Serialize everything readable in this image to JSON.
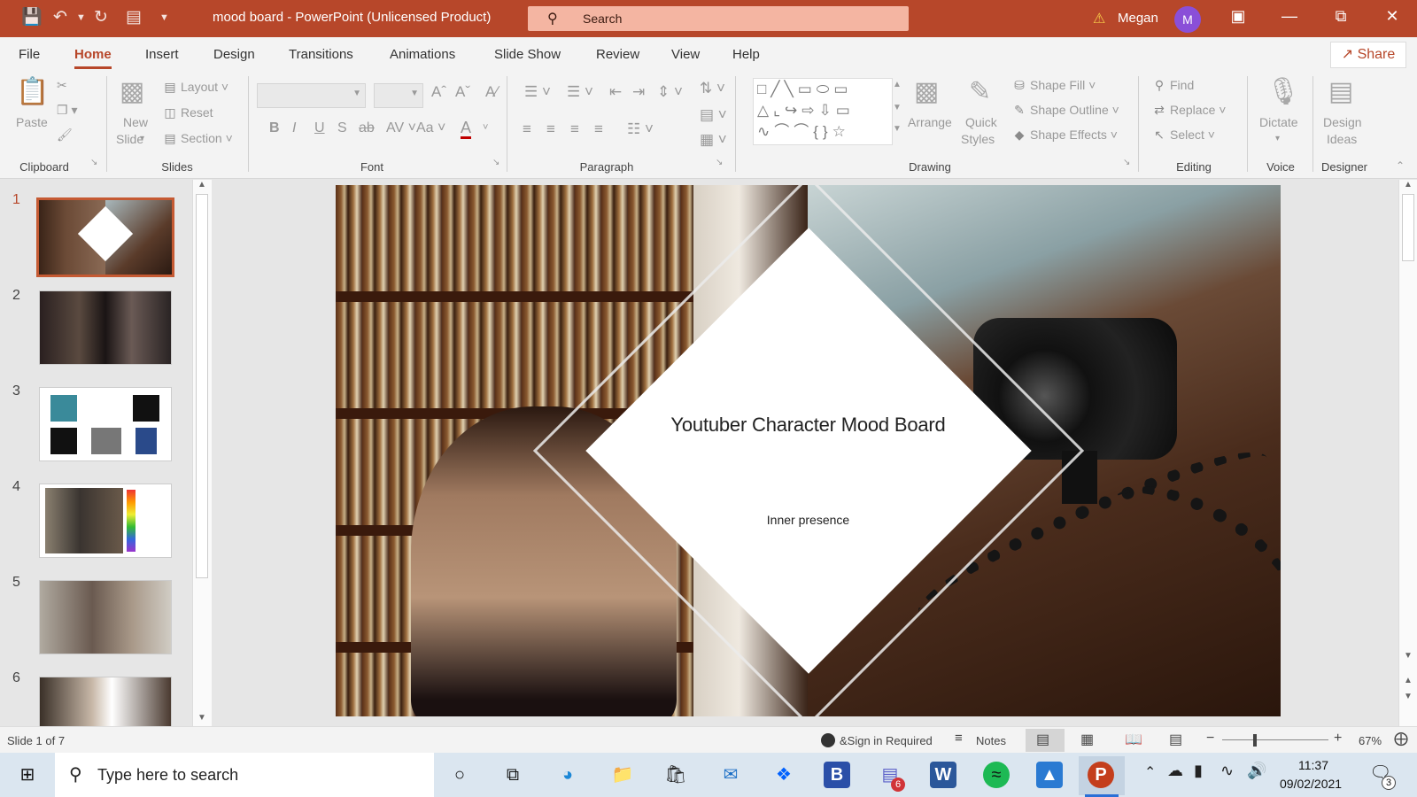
{
  "titlebar": {
    "doc_title": "mood board  -  PowerPoint (Unlicensed Product)",
    "search_placeholder": "Search",
    "user_name": "Megan",
    "user_initial": "M"
  },
  "tabs": [
    "File",
    "Home",
    "Insert",
    "Design",
    "Transitions",
    "Animations",
    "Slide Show",
    "Review",
    "View",
    "Help"
  ],
  "share_label": "Share",
  "ribbon": {
    "clipboard": {
      "paste": "Paste",
      "label": "Clipboard"
    },
    "slides": {
      "new_slide_1": "New",
      "new_slide_2": "Slide",
      "layout": "Layout",
      "reset": "Reset",
      "section": "Section",
      "label": "Slides"
    },
    "font": {
      "bold": "B",
      "italic": "I",
      "underline": "U",
      "strike": "S",
      "abc": "ab",
      "spacing": "AV",
      "case": "Aa",
      "color": "A",
      "label": "Font"
    },
    "paragraph": {
      "label": "Paragraph"
    },
    "drawing": {
      "arrange": "Arrange",
      "quick_1": "Quick",
      "quick_2": "Styles",
      "shape_fill": "Shape Fill",
      "shape_outline": "Shape Outline",
      "shape_effects": "Shape Effects",
      "label": "Drawing"
    },
    "editing": {
      "find": "Find",
      "replace": "Replace",
      "select": "Select",
      "label": "Editing"
    },
    "voice": {
      "dictate": "Dictate",
      "label": "Voice"
    },
    "designer": {
      "ideas_1": "Design",
      "ideas_2": "Ideas",
      "label": "Designer"
    }
  },
  "thumbnails": [
    "1",
    "2",
    "3",
    "4",
    "5",
    "6"
  ],
  "slide": {
    "title": "Youtuber Character Mood Board",
    "subtitle": "Inner presence"
  },
  "status": {
    "slide_count": "Slide 1 of 7",
    "sign_in": "&Sign in Required",
    "notes": "Notes",
    "zoom": "67%"
  },
  "taskbar": {
    "search_placeholder": "Type here to search",
    "time": "11:37",
    "date": "09/02/2021",
    "teams_badge": "6",
    "notif_count": "3"
  },
  "colors": {
    "accent": "#b7472a",
    "search_bg": "#f4b5a2",
    "avatar": "#8a4fd8"
  }
}
